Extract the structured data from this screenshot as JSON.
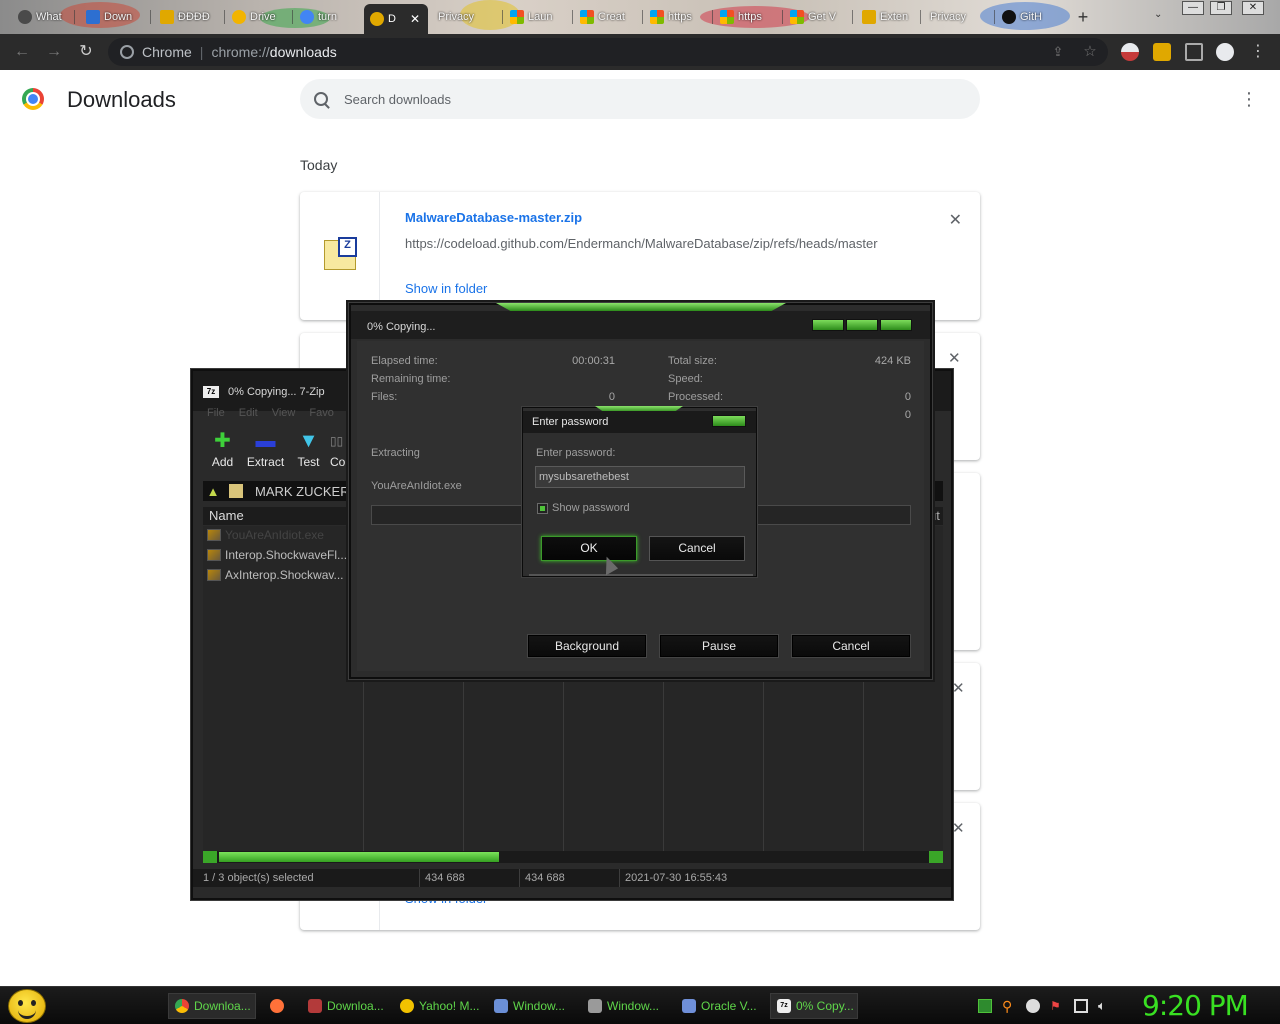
{
  "browser": {
    "tabs": [
      {
        "label": "What",
        "color": "#4a4a4a"
      },
      {
        "label": "Down",
        "color": "#2d6fd1"
      },
      {
        "label": "ĐĐĐĐ",
        "color": "#e0a800"
      },
      {
        "label": "Drive",
        "color": "#f2b400"
      },
      {
        "label": "turn",
        "color": "#4285f4"
      },
      {
        "label": "D",
        "color": "#e0a800",
        "active": true
      },
      {
        "label": "Privacy",
        "color": "#ffffff"
      },
      {
        "label": "Laun",
        "color": "#f25022"
      },
      {
        "label": "Creat",
        "color": "#f25022"
      },
      {
        "label": "https",
        "color": "#f25022"
      },
      {
        "label": "https",
        "color": "#f25022"
      },
      {
        "label": "Get V",
        "color": "#f25022"
      },
      {
        "label": "Exten",
        "color": "#e0a800"
      },
      {
        "label": "Privacy",
        "color": "#ffffff"
      },
      {
        "label": "GitH",
        "color": "#111111"
      }
    ],
    "active_tab_close": "✕",
    "new_tab": "+",
    "omnibox": {
      "origin": "Chrome",
      "divider": "|",
      "scheme": "chrome://",
      "host": "downloads"
    }
  },
  "downloads_page": {
    "title": "Downloads",
    "search_placeholder": "Search downloads",
    "date_group": "Today",
    "items": [
      {
        "filename": "MalwareDatabase-master.zip",
        "url": "https://codeload.github.com/Endermanch/MalwareDatabase/zip/refs/heads/master",
        "action": "Show in folder"
      }
    ],
    "bottom_action": "Show in folder"
  },
  "zip_manager": {
    "title": "0% Copying... 7-Zip",
    "menu": [
      "File",
      "Edit",
      "View",
      "Favo"
    ],
    "toolbar": [
      {
        "label": "Add",
        "icon": "add-icon"
      },
      {
        "label": "Extract",
        "icon": "extract-icon"
      },
      {
        "label": "Test",
        "icon": "test-icon"
      },
      {
        "label": "Co",
        "icon": "copy-icon"
      }
    ],
    "path": "MARK ZUCKER",
    "column_name": "Name",
    "column_right": "ut",
    "files": [
      "YouAreAnIdiot.exe",
      "Interop.ShockwaveFl...",
      "AxInterop.Shockwav..."
    ],
    "status": {
      "selected": "1 / 3 object(s) selected",
      "size": "434 688",
      "packed": "434 688",
      "modified": "2021-07-30 16:55:43"
    }
  },
  "copy_dialog": {
    "title": "0% Copying...",
    "elapsed_label": "Elapsed time:",
    "elapsed_value": "00:00:31",
    "remaining_label": "Remaining time:",
    "files_label": "Files:",
    "files_value": "0",
    "total_size_label": "Total size:",
    "total_size_value": "424 KB",
    "speed_label": "Speed:",
    "processed_label": "Processed:",
    "processed_value": "0",
    "extra_value": "0",
    "operation": "Extracting",
    "current_file": "YouAreAnIdiot.exe",
    "buttons": {
      "background": "Background",
      "pause": "Pause",
      "cancel": "Cancel"
    }
  },
  "password_dialog": {
    "title": "Enter password",
    "prompt": "Enter password:",
    "value": "mysubsarethebest",
    "show_password_label": "Show password",
    "show_password_checked": true,
    "ok": "OK",
    "cancel": "Cancel"
  },
  "taskbar": {
    "items": [
      {
        "label": "Downloa...",
        "color": "#4285f4",
        "active": true
      },
      {
        "label": "",
        "color": "#ff7139"
      },
      {
        "label": "Downloa...",
        "color": "#b33a3a"
      },
      {
        "label": "Yahoo! M...",
        "color": "#f2c200"
      },
      {
        "label": "Window...",
        "color": "#6b8fd6"
      },
      {
        "label": "Window...",
        "color": "#9a9a9a"
      },
      {
        "label": "Oracle V...",
        "color": "#6f8fd8"
      },
      {
        "label": "0% Copy...",
        "color": "#eeeeee",
        "active": true
      }
    ],
    "clock": "9:20 PM"
  },
  "colors": {
    "accent_green": "#39e022",
    "link_blue": "#1a73e8"
  }
}
